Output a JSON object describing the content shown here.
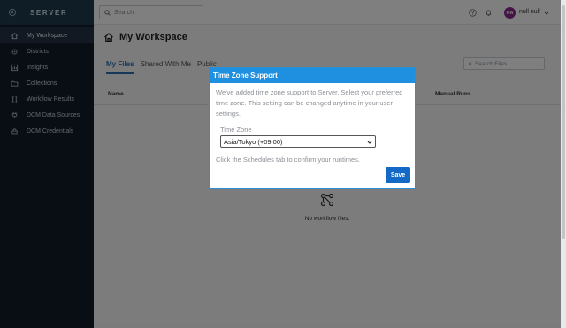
{
  "app": {
    "brand_name": "SERVER",
    "colors": {
      "sidebar_bg": "#131c2b",
      "accent": "#2d6fb3",
      "modal_header": "#1f8fe0",
      "save_button": "#1469c7",
      "avatar": "#8a2a8c"
    }
  },
  "sidebar": {
    "items": [
      {
        "label": "My Workspace",
        "icon": "home-icon",
        "active": true
      },
      {
        "label": "Districts",
        "icon": "gear-icon"
      },
      {
        "label": "Insights",
        "icon": "chart-icon"
      },
      {
        "label": "Collections",
        "icon": "folder-icon"
      },
      {
        "label": "Workflow Results",
        "icon": "results-icon"
      },
      {
        "label": "DCM Data Sources",
        "icon": "plug-icon"
      },
      {
        "label": "DCM Credentials",
        "icon": "lock-icon"
      }
    ]
  },
  "topbar": {
    "search_placeholder": "Search",
    "avatar_initials": "NA",
    "username": "null null"
  },
  "main": {
    "page_title": "My Workspace",
    "tabs": [
      {
        "label": "My Files",
        "active": true
      },
      {
        "label": "Shared With Me"
      },
      {
        "label": "Public"
      }
    ],
    "files_search_placeholder": "Search Files",
    "columns": {
      "name": "Name",
      "manual_runs": "Manual Runs"
    },
    "empty_text": "No workflow files."
  },
  "modal": {
    "title": "Time Zone Support",
    "message": "We've added time zone support to Server. Select your preferred time zone. This setting can be changed anytime in your user settings.",
    "tz_label": "Time Zone",
    "tz_value": "Asia/Tokyo (+09:00)",
    "hint": "Click the Schedules tab to confirm your runtimes.",
    "save_label": "Save"
  }
}
